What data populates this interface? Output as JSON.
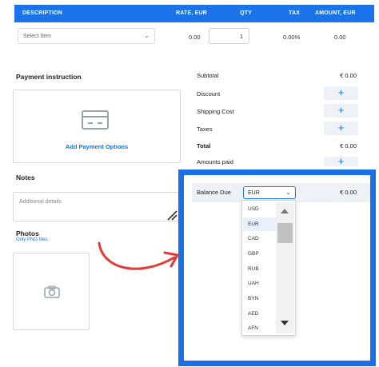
{
  "table": {
    "headers": [
      "DESCRIPTION",
      "RATE, EUR",
      "QTY",
      "TAX",
      "AMOUNT, EUR"
    ],
    "row": {
      "select_placeholder": "Select Item",
      "rate": "0.00",
      "qty": "1",
      "tax": "0.00%",
      "amount": "0.00"
    }
  },
  "payment": {
    "title": "Payment instruction",
    "add_label": "Add Payment Options"
  },
  "notes": {
    "title": "Notes",
    "placeholder": "Additional details"
  },
  "photos": {
    "title": "Photos",
    "subtitle": "Only PNG files."
  },
  "summary": {
    "subtotal_label": "Subtotal",
    "subtotal_value": "€ 0.00",
    "discount_label": "Discount",
    "shipping_label": "Shipping Cost",
    "taxes_label": "Taxes",
    "total_label": "Total",
    "total_value": "€ 0.00",
    "amounts_paid_label": "Amounts paid",
    "balance_label": "Balance Due",
    "balance_value": "€ 0.00",
    "plus": "+"
  },
  "currency": {
    "selected": "EUR",
    "options": [
      "USD",
      "EUR",
      "CAD",
      "GBP",
      "RUB",
      "UAH",
      "BYN",
      "AED",
      "AFN"
    ]
  },
  "colors": {
    "accent": "#1a73e8",
    "highlight_frame": "#1a6fe6",
    "arrow": "#e53935"
  }
}
